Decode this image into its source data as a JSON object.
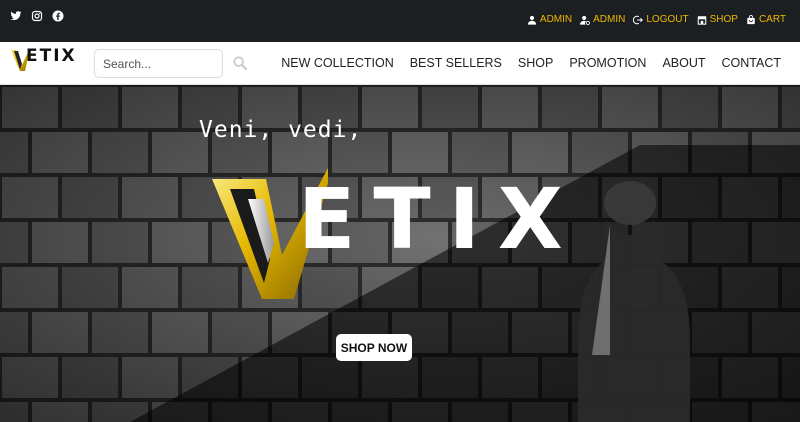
{
  "social": [
    {
      "name": "twitter-icon"
    },
    {
      "name": "instagram-icon"
    },
    {
      "name": "facebook-icon"
    }
  ],
  "account": {
    "items": [
      {
        "label": "ADMIN",
        "icon": "user-icon"
      },
      {
        "label": "ADMIN",
        "icon": "admin-gear-icon"
      },
      {
        "label": "LOGOUT",
        "icon": "logout-icon"
      },
      {
        "label": "SHOP",
        "icon": "shop-icon"
      },
      {
        "label": "CART",
        "icon": "cart-icon"
      }
    ],
    "color": "#f0b800"
  },
  "logo": {
    "text": "ETIX"
  },
  "search": {
    "placeholder": "Search..."
  },
  "nav": {
    "items": [
      "NEW COLLECTION",
      "BEST SELLERS",
      "SHOP",
      "PROMOTION",
      "ABOUT",
      "CONTACT"
    ]
  },
  "hero": {
    "tagline": "Veni, vedi,",
    "brand": "ETIX",
    "cta": "SHOP NOW"
  },
  "colors": {
    "topbar": "#1c1f22",
    "accent": "#f0b800"
  }
}
